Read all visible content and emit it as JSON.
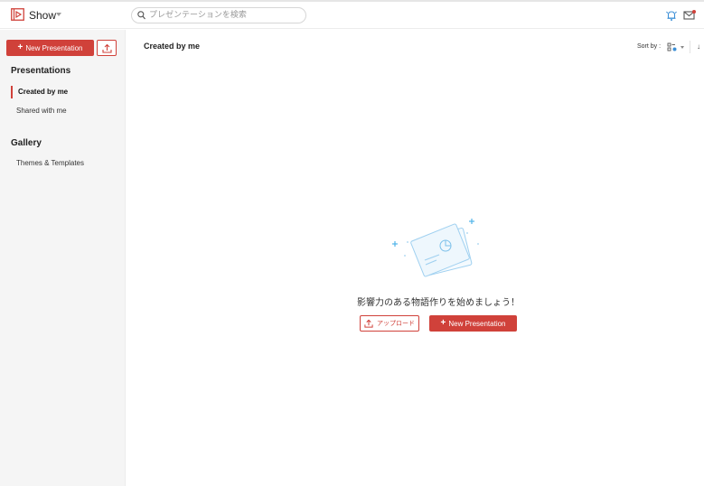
{
  "app": {
    "title": "Show"
  },
  "search": {
    "placeholder": "プレゼンテーションを検索"
  },
  "sidebar": {
    "new_button_label": "New Presentation",
    "sections": [
      {
        "title": "Presentations",
        "items": [
          {
            "label": "Created by me",
            "active": true
          },
          {
            "label": "Shared with me",
            "active": false
          }
        ]
      },
      {
        "title": "Gallery",
        "items": [
          {
            "label": "Themes & Templates",
            "active": false
          }
        ]
      }
    ]
  },
  "main": {
    "title": "Created by me",
    "sort": {
      "label": "Sort by :",
      "direction_symbol": "↓"
    },
    "empty_state": {
      "message": "影響力のある物語作りを始めましょう！",
      "upload_label": "アップロード",
      "new_label": "New Presentation"
    }
  },
  "icons": {
    "logo": "show-logo-icon",
    "notifications": "bell-icon",
    "mail": "mail-icon",
    "upload": "upload-icon",
    "sort": "sort-options-icon"
  },
  "colors": {
    "accent": "#d0413a",
    "sidebar_bg": "#f5f5f5",
    "illustration": "#4fb3e8"
  }
}
